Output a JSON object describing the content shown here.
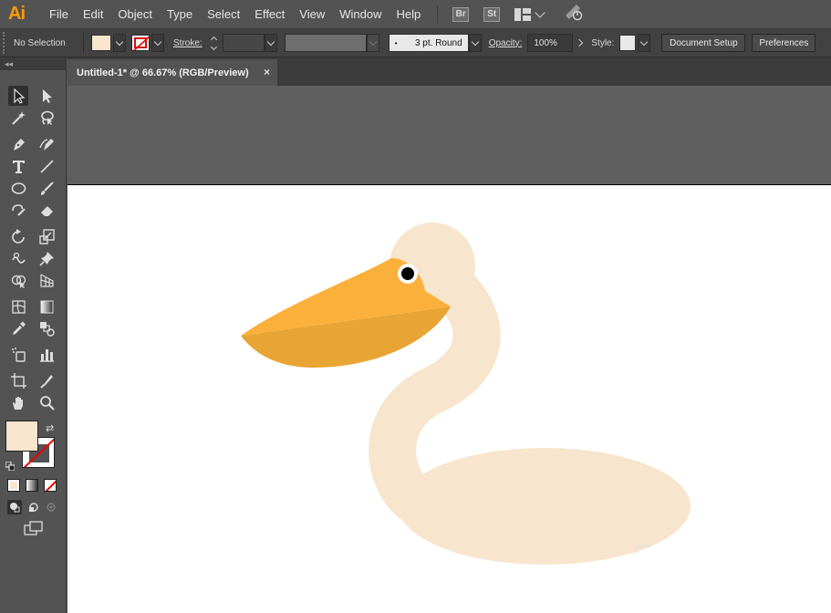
{
  "app": {
    "logo": "Ai"
  },
  "menu": [
    "File",
    "Edit",
    "Object",
    "Type",
    "Select",
    "Effect",
    "View",
    "Window",
    "Help"
  ],
  "app_buttons": {
    "bridge": "Br",
    "stock": "St"
  },
  "control": {
    "selection_status": "No Selection",
    "fill_color": "#f8e5cd",
    "stroke_label": "Stroke:",
    "stroke_weight": "",
    "brush_label": "3 pt. Round",
    "opacity_label": "Opacity:",
    "opacity_value": "100%",
    "style_label": "Style:",
    "document_setup": "Document Setup",
    "preferences": "Preferences"
  },
  "toolbar": {
    "collapse": "◂◂"
  },
  "document": {
    "tab_title": "Untitled-1* @ 66.67% (RGB/Preview)",
    "close": "×"
  },
  "colors": {
    "pelican_body": "#f8e5cd",
    "beak_top": "#fbb03b",
    "beak_bottom": "#e8a533",
    "eye": "#000000"
  }
}
